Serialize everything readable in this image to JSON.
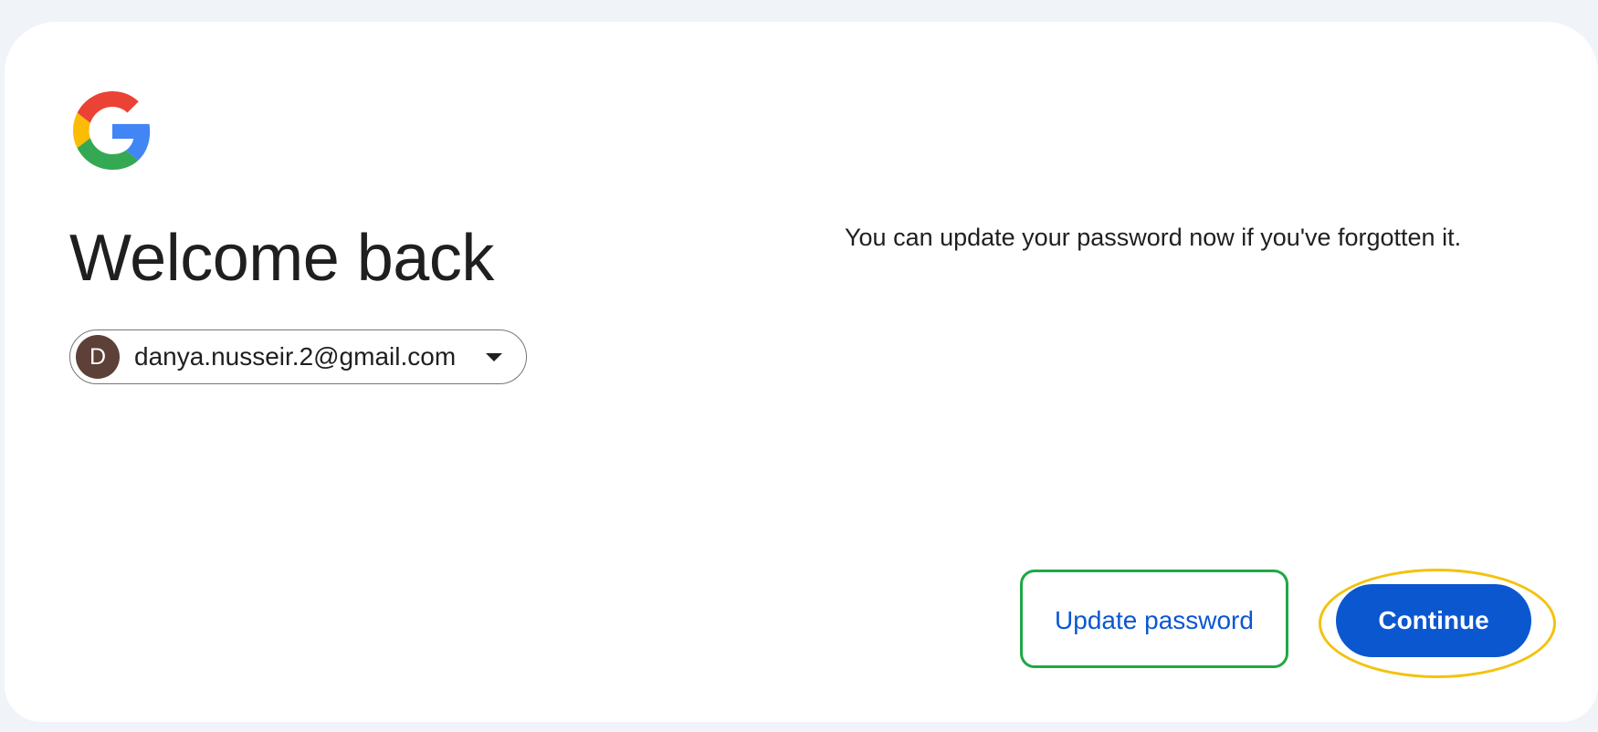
{
  "logo": {
    "icon": "google-g-icon",
    "colors": {
      "red": "#EA4335",
      "yellow": "#FBBC05",
      "green": "#34A853",
      "blue": "#4285F4"
    }
  },
  "heading": {
    "title": "Welcome back"
  },
  "account": {
    "avatar_initial": "D",
    "avatar_color": "#5d4037",
    "email": "danya.nusseir.2@gmail.com",
    "dropdown_icon": "chevron-down-icon"
  },
  "message": {
    "text": "You can update your password now if you've forgotten it."
  },
  "actions": {
    "update_password_label": "Update password",
    "continue_label": "Continue",
    "primary_color": "#0b57d0",
    "highlight_green": "#1fa847",
    "highlight_yellow": "#f4c20d"
  }
}
